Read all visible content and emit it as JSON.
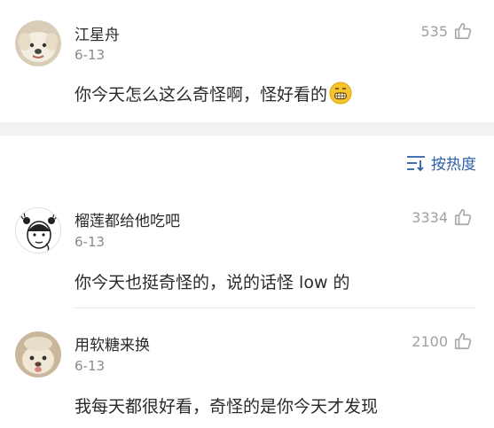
{
  "colors": {
    "link": "#2c5ea8",
    "muted": "#a0a0a0",
    "divider": "#f2f2f2",
    "text": "#2a2a2a"
  },
  "top_comment": {
    "username": "江星舟",
    "date": "6-13",
    "text": "你今天怎么这么奇怪啊，怪好看的",
    "emoji": "grinning-face-icon",
    "likes": "535"
  },
  "sort": {
    "label": "按热度",
    "icon": "sort-icon"
  },
  "comments": [
    {
      "username": "榴莲都给他吃吧",
      "date": "6-13",
      "text": "你今天也挺奇怪的，说的话怪 low 的",
      "likes": "3334"
    },
    {
      "username": "用软糖来换",
      "date": "6-13",
      "text": "我每天都很好看，奇怪的是你今天才发现",
      "likes": "2100"
    }
  ]
}
